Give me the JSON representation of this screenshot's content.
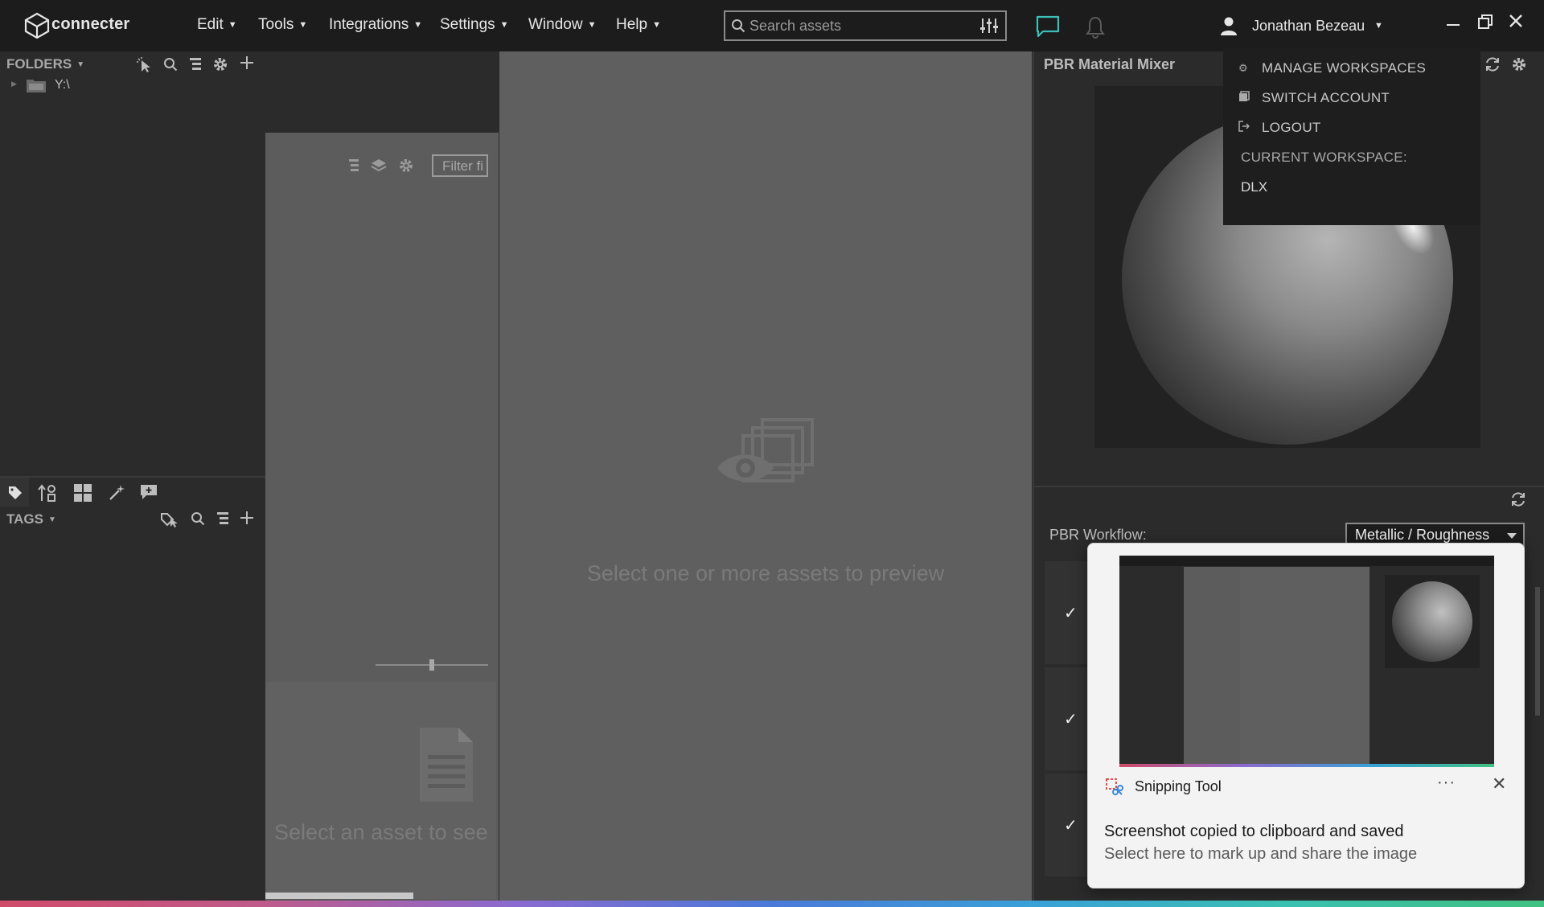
{
  "app": {
    "logo_text": "connecter"
  },
  "menu": {
    "items": [
      {
        "label": "Edit"
      },
      {
        "label": "Tools"
      },
      {
        "label": "Integrations"
      },
      {
        "label": "Settings"
      },
      {
        "label": "Window"
      },
      {
        "label": "Help"
      }
    ]
  },
  "search": {
    "placeholder": "Search assets"
  },
  "user": {
    "name": "Jonathan Bezeau"
  },
  "user_menu": {
    "items": [
      {
        "label": "MANAGE WORKSPACES",
        "icon": "gear-icon"
      },
      {
        "label": "SWITCH ACCOUNT",
        "icon": "accounts-icon"
      },
      {
        "label": "LOGOUT",
        "icon": "logout-icon"
      }
    ],
    "current_workspace_label": "CURRENT WORKSPACE:",
    "current_workspace_value": "DLX"
  },
  "folders": {
    "title": "FOLDERS",
    "tree": [
      {
        "label": "Y:\\"
      }
    ]
  },
  "tags": {
    "title": "TAGS"
  },
  "assets": {
    "filter_placeholder": "Filter fi",
    "empty_text": "Select an asset to see",
    "zoom_slider_value": 0.5
  },
  "preview": {
    "empty_text": "Select one or more assets to preview"
  },
  "pbr": {
    "title": "PBR Material Mixer",
    "workflow_label": "PBR Workflow:",
    "workflow_value": "Metallic / Roughness"
  },
  "toast": {
    "app_name": "Snipping Tool",
    "more": "···",
    "close": "✕",
    "message": "Screenshot copied to clipboard and saved",
    "sub_message": "Select here to mark up and share the image"
  },
  "colors": {
    "accent_chat": "#3cc0b8",
    "topbar_bg": "#1c1c1c",
    "panel_bg": "#2b2b2b"
  }
}
